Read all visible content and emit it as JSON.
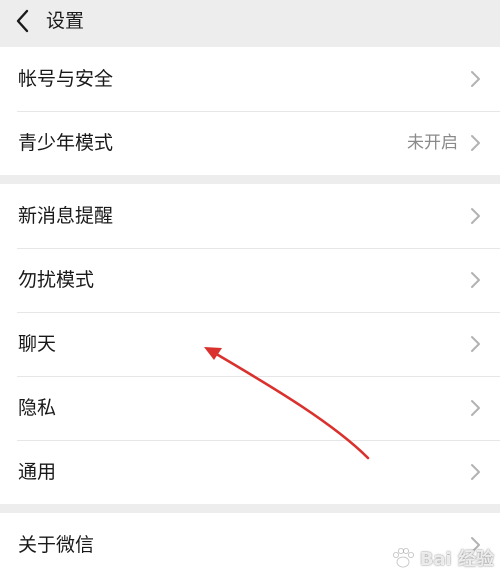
{
  "header": {
    "title": "设置"
  },
  "groups": [
    {
      "items": [
        {
          "label": "帐号与安全",
          "value": ""
        },
        {
          "label": "青少年模式",
          "value": "未开启"
        }
      ]
    },
    {
      "items": [
        {
          "label": "新消息提醒",
          "value": ""
        },
        {
          "label": "勿扰模式",
          "value": ""
        },
        {
          "label": "聊天",
          "value": ""
        },
        {
          "label": "隐私",
          "value": ""
        },
        {
          "label": "通用",
          "value": ""
        }
      ]
    },
    {
      "items": [
        {
          "label": "关于微信",
          "value": ""
        }
      ]
    }
  ],
  "annotation": {
    "color": "#d9322e"
  },
  "watermark": {
    "text": "Bai 经验",
    "color": "#ffffff"
  },
  "icons": {
    "back": "chevron-left-icon",
    "row": "chevron-right-icon",
    "watermark": "paw-icon"
  }
}
